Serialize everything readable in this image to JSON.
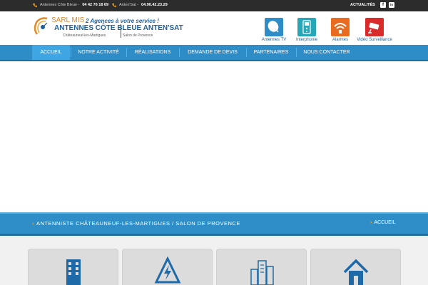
{
  "topbar": {
    "phone1_name": "Antennes Côte Bleue - ",
    "phone1_number": "04 42 76 18 69",
    "phone2_name": "Anten'Sat - ",
    "phone2_number": "04.90.42.23.29",
    "news_label": "ACTUALITÉS",
    "facebook_glyph": "f",
    "linkedin_glyph": "in"
  },
  "logo": {
    "company_type": "SARL MIS",
    "tagline": "2 Agences à votre service !",
    "brand_line": "ANTENNES CÔTE BLEUE  ANTEN'SAT",
    "city_left": "Châteauneuf-les-Martigues",
    "city_right": "Salon de Provence"
  },
  "services": [
    {
      "label": "Antennes TV",
      "icon": "satellite-dish-icon",
      "color": "#2e8cc7"
    },
    {
      "label": "Interphonie",
      "icon": "intercom-icon",
      "color": "#25a7b8"
    },
    {
      "label": "Alarmes",
      "icon": "wifi-alarm-icon",
      "color": "#e86b1f"
    },
    {
      "label": "Vidéo Surveillance",
      "icon": "security-camera-icon",
      "color": "#d92b2b"
    }
  ],
  "nav": {
    "items": [
      "Accueil",
      "Notre activité",
      "Réalisations",
      "Demande de devis",
      "Partenaires",
      "Nous contacter"
    ],
    "active_index": 0
  },
  "band": {
    "page_title": "Antenniste Châteauneuf-les-Martigues / Salon de Provence",
    "breadcrumb": "Accueil"
  },
  "cards": [
    {
      "icon": "building-icon"
    },
    {
      "icon": "electricity-icon"
    },
    {
      "icon": "city-buildings-icon"
    },
    {
      "icon": "house-icon"
    }
  ],
  "colors": {
    "nav_bar": "#2e8cc7",
    "nav_active": "#3ea6e3",
    "accent": "#f5a623",
    "brand_blue": "#1f5f9e",
    "brand_orange": "#e08a2c"
  }
}
